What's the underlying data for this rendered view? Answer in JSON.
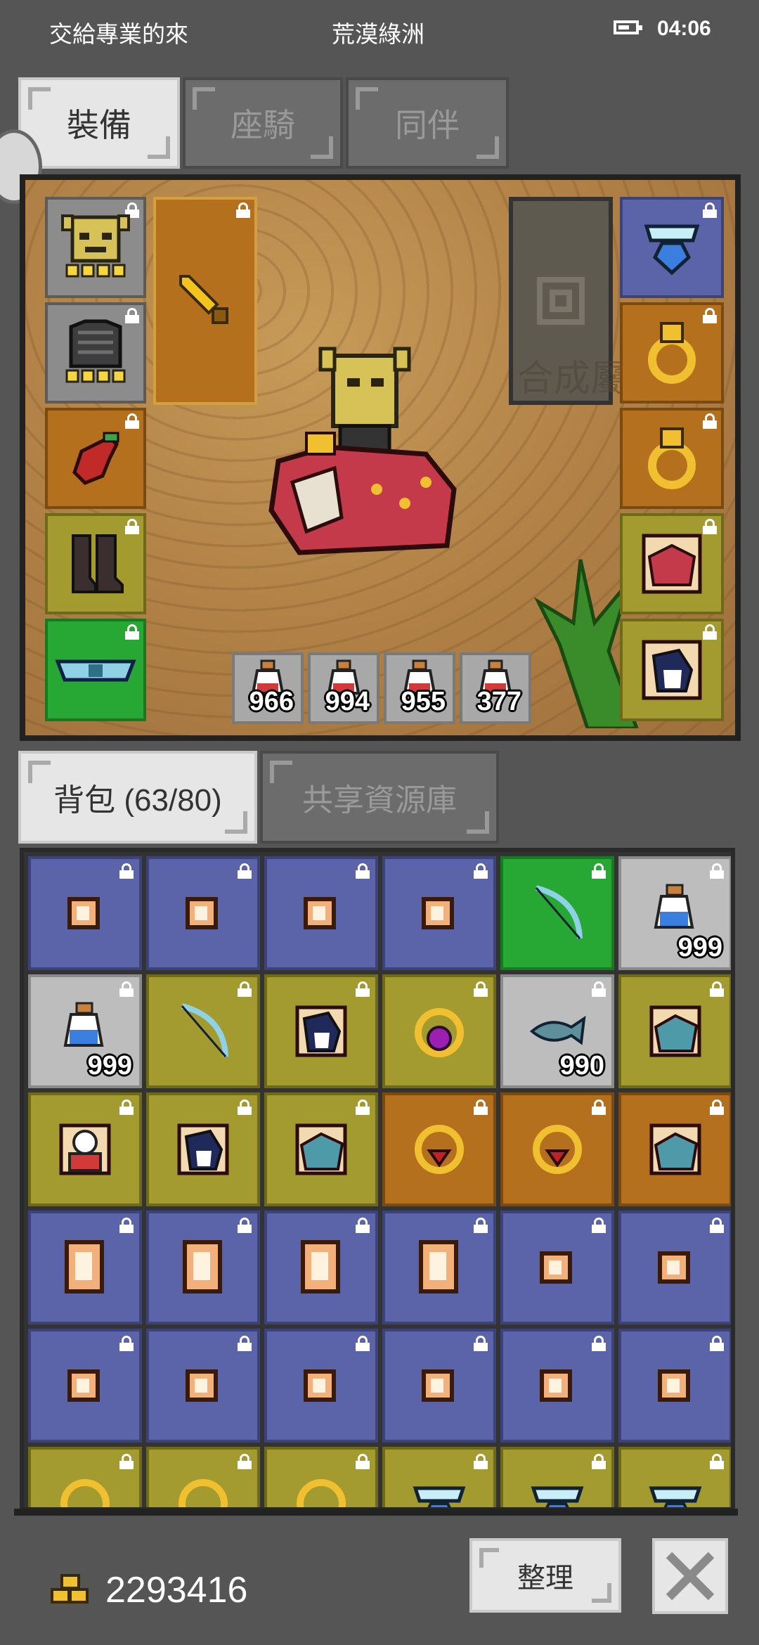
{
  "status_bar": {
    "guild": "交給專業的來",
    "zone": "荒漠綠洲",
    "time": "04:06"
  },
  "equip_tabs": [
    {
      "label": "裝備",
      "active": true
    },
    {
      "label": "座騎",
      "active": false
    },
    {
      "label": "同伴",
      "active": false
    }
  ],
  "equipment": {
    "panel_watermark": "合成屬性",
    "potions": [
      {
        "name": "potion-icon",
        "count": "966"
      },
      {
        "name": "potion-icon",
        "count": "994"
      },
      {
        "name": "potion-icon",
        "count": "955"
      },
      {
        "name": "potion-icon",
        "count": "377"
      }
    ],
    "left_slots": [
      "helmet-icon",
      "armor-icon",
      "gloves-icon",
      "boots-icon",
      "belt-icon"
    ],
    "weapon_slot": "sword-icon",
    "right_slots": [
      "necklace-icon",
      "ring-icon",
      "ring-icon",
      "mount-card-icon",
      "pet-penguin-icon"
    ]
  },
  "bag_tabs": [
    {
      "label": "背包 (63/80)",
      "active": true
    },
    {
      "label": "共享資源庫",
      "active": false
    }
  ],
  "bag_items": [
    {
      "color": "blue",
      "icon": "scroll-small-icon"
    },
    {
      "color": "blue",
      "icon": "scroll-small-icon"
    },
    {
      "color": "blue",
      "icon": "scroll-small-icon"
    },
    {
      "color": "blue",
      "icon": "scroll-small-icon"
    },
    {
      "color": "green",
      "icon": "bow-icon"
    },
    {
      "color": "lgray",
      "icon": "potion-icon",
      "qty": "999"
    },
    {
      "color": "lgray",
      "icon": "potion-icon",
      "qty": "999"
    },
    {
      "color": "olive",
      "icon": "bow-icon"
    },
    {
      "color": "olive",
      "icon": "pet-penguin-icon"
    },
    {
      "color": "olive",
      "icon": "amulet-purple-icon"
    },
    {
      "color": "lgray",
      "icon": "fish-icon",
      "qty": "990"
    },
    {
      "color": "olive",
      "icon": "mount-card-icon"
    },
    {
      "color": "olive",
      "icon": "pet-snowman-icon"
    },
    {
      "color": "olive",
      "icon": "pet-penguin-icon"
    },
    {
      "color": "olive",
      "icon": "mount-card-icon"
    },
    {
      "color": "brown",
      "icon": "amulet-red-icon"
    },
    {
      "color": "brown",
      "icon": "amulet-red-icon"
    },
    {
      "color": "brown",
      "icon": "mount-card-icon"
    },
    {
      "color": "blue",
      "icon": "scroll-large-icon"
    },
    {
      "color": "blue",
      "icon": "scroll-large-icon"
    },
    {
      "color": "blue",
      "icon": "scroll-large-icon"
    },
    {
      "color": "blue",
      "icon": "scroll-large-icon"
    },
    {
      "color": "blue",
      "icon": "scroll-small-icon"
    },
    {
      "color": "blue",
      "icon": "scroll-small-icon"
    },
    {
      "color": "blue",
      "icon": "scroll-small-icon"
    },
    {
      "color": "blue",
      "icon": "scroll-small-icon"
    },
    {
      "color": "blue",
      "icon": "scroll-small-icon"
    },
    {
      "color": "blue",
      "icon": "scroll-small-icon"
    },
    {
      "color": "blue",
      "icon": "scroll-small-icon"
    },
    {
      "color": "blue",
      "icon": "scroll-small-icon"
    },
    {
      "color": "olive",
      "icon": "amulet-icon"
    },
    {
      "color": "olive",
      "icon": "amulet-icon"
    },
    {
      "color": "olive",
      "icon": "amulet-icon"
    },
    {
      "color": "olive",
      "icon": "necklace-icon"
    },
    {
      "color": "olive",
      "icon": "necklace-icon"
    },
    {
      "color": "olive",
      "icon": "necklace-icon"
    }
  ],
  "footer": {
    "gold": "2293416",
    "sort_label": "整理"
  },
  "colors": {
    "background": "#555555",
    "blue_slot": "#5b64a8",
    "olive_slot": "#a39b2f",
    "brown_slot": "#b4701c",
    "green_slot": "#27a733"
  }
}
